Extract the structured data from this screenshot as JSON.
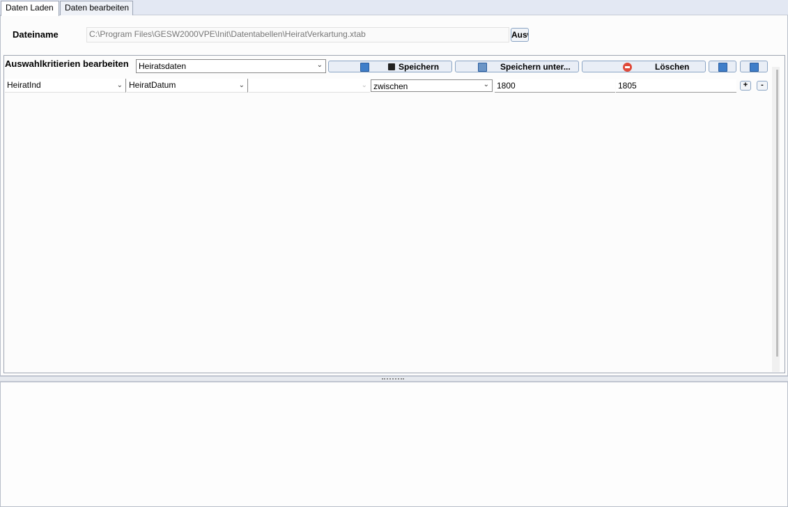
{
  "tabs": [
    {
      "label": "Daten Laden",
      "active": true
    },
    {
      "label": "Daten bearbeiten",
      "active": false
    }
  ],
  "file": {
    "label": "Dateiname",
    "path": "C:\\Program Files\\GESW2000VPE\\Init\\Datentabellen\\HeiratVerkartung.xtab",
    "browse_label": "Ausw"
  },
  "criteria": {
    "title": "Auswahlkritierien bearbeiten",
    "preset": "Heiratsdaten",
    "save_label": "Speichern",
    "save_as_label": "Speichern unter...",
    "delete_label": "Löschen"
  },
  "filter_row": {
    "table": "HeiratInd",
    "field": "HeiratDatum",
    "third": "",
    "operator": "zwischen",
    "value_from": "1800",
    "value_to": "1805",
    "add_label": "+",
    "remove_label": "-"
  },
  "icons": {
    "save": "floppy-disk-icon",
    "save_as": "floppy-disk-edit-icon",
    "delete": "stop-sign-icon",
    "dropdown": "chevron-down-icon"
  },
  "colors": {
    "tab_strip": "#e3e8f3",
    "button_border": "#8aa4c4",
    "floppy_blue": "#3f7ec9",
    "delete_red": "#e04a3a"
  }
}
